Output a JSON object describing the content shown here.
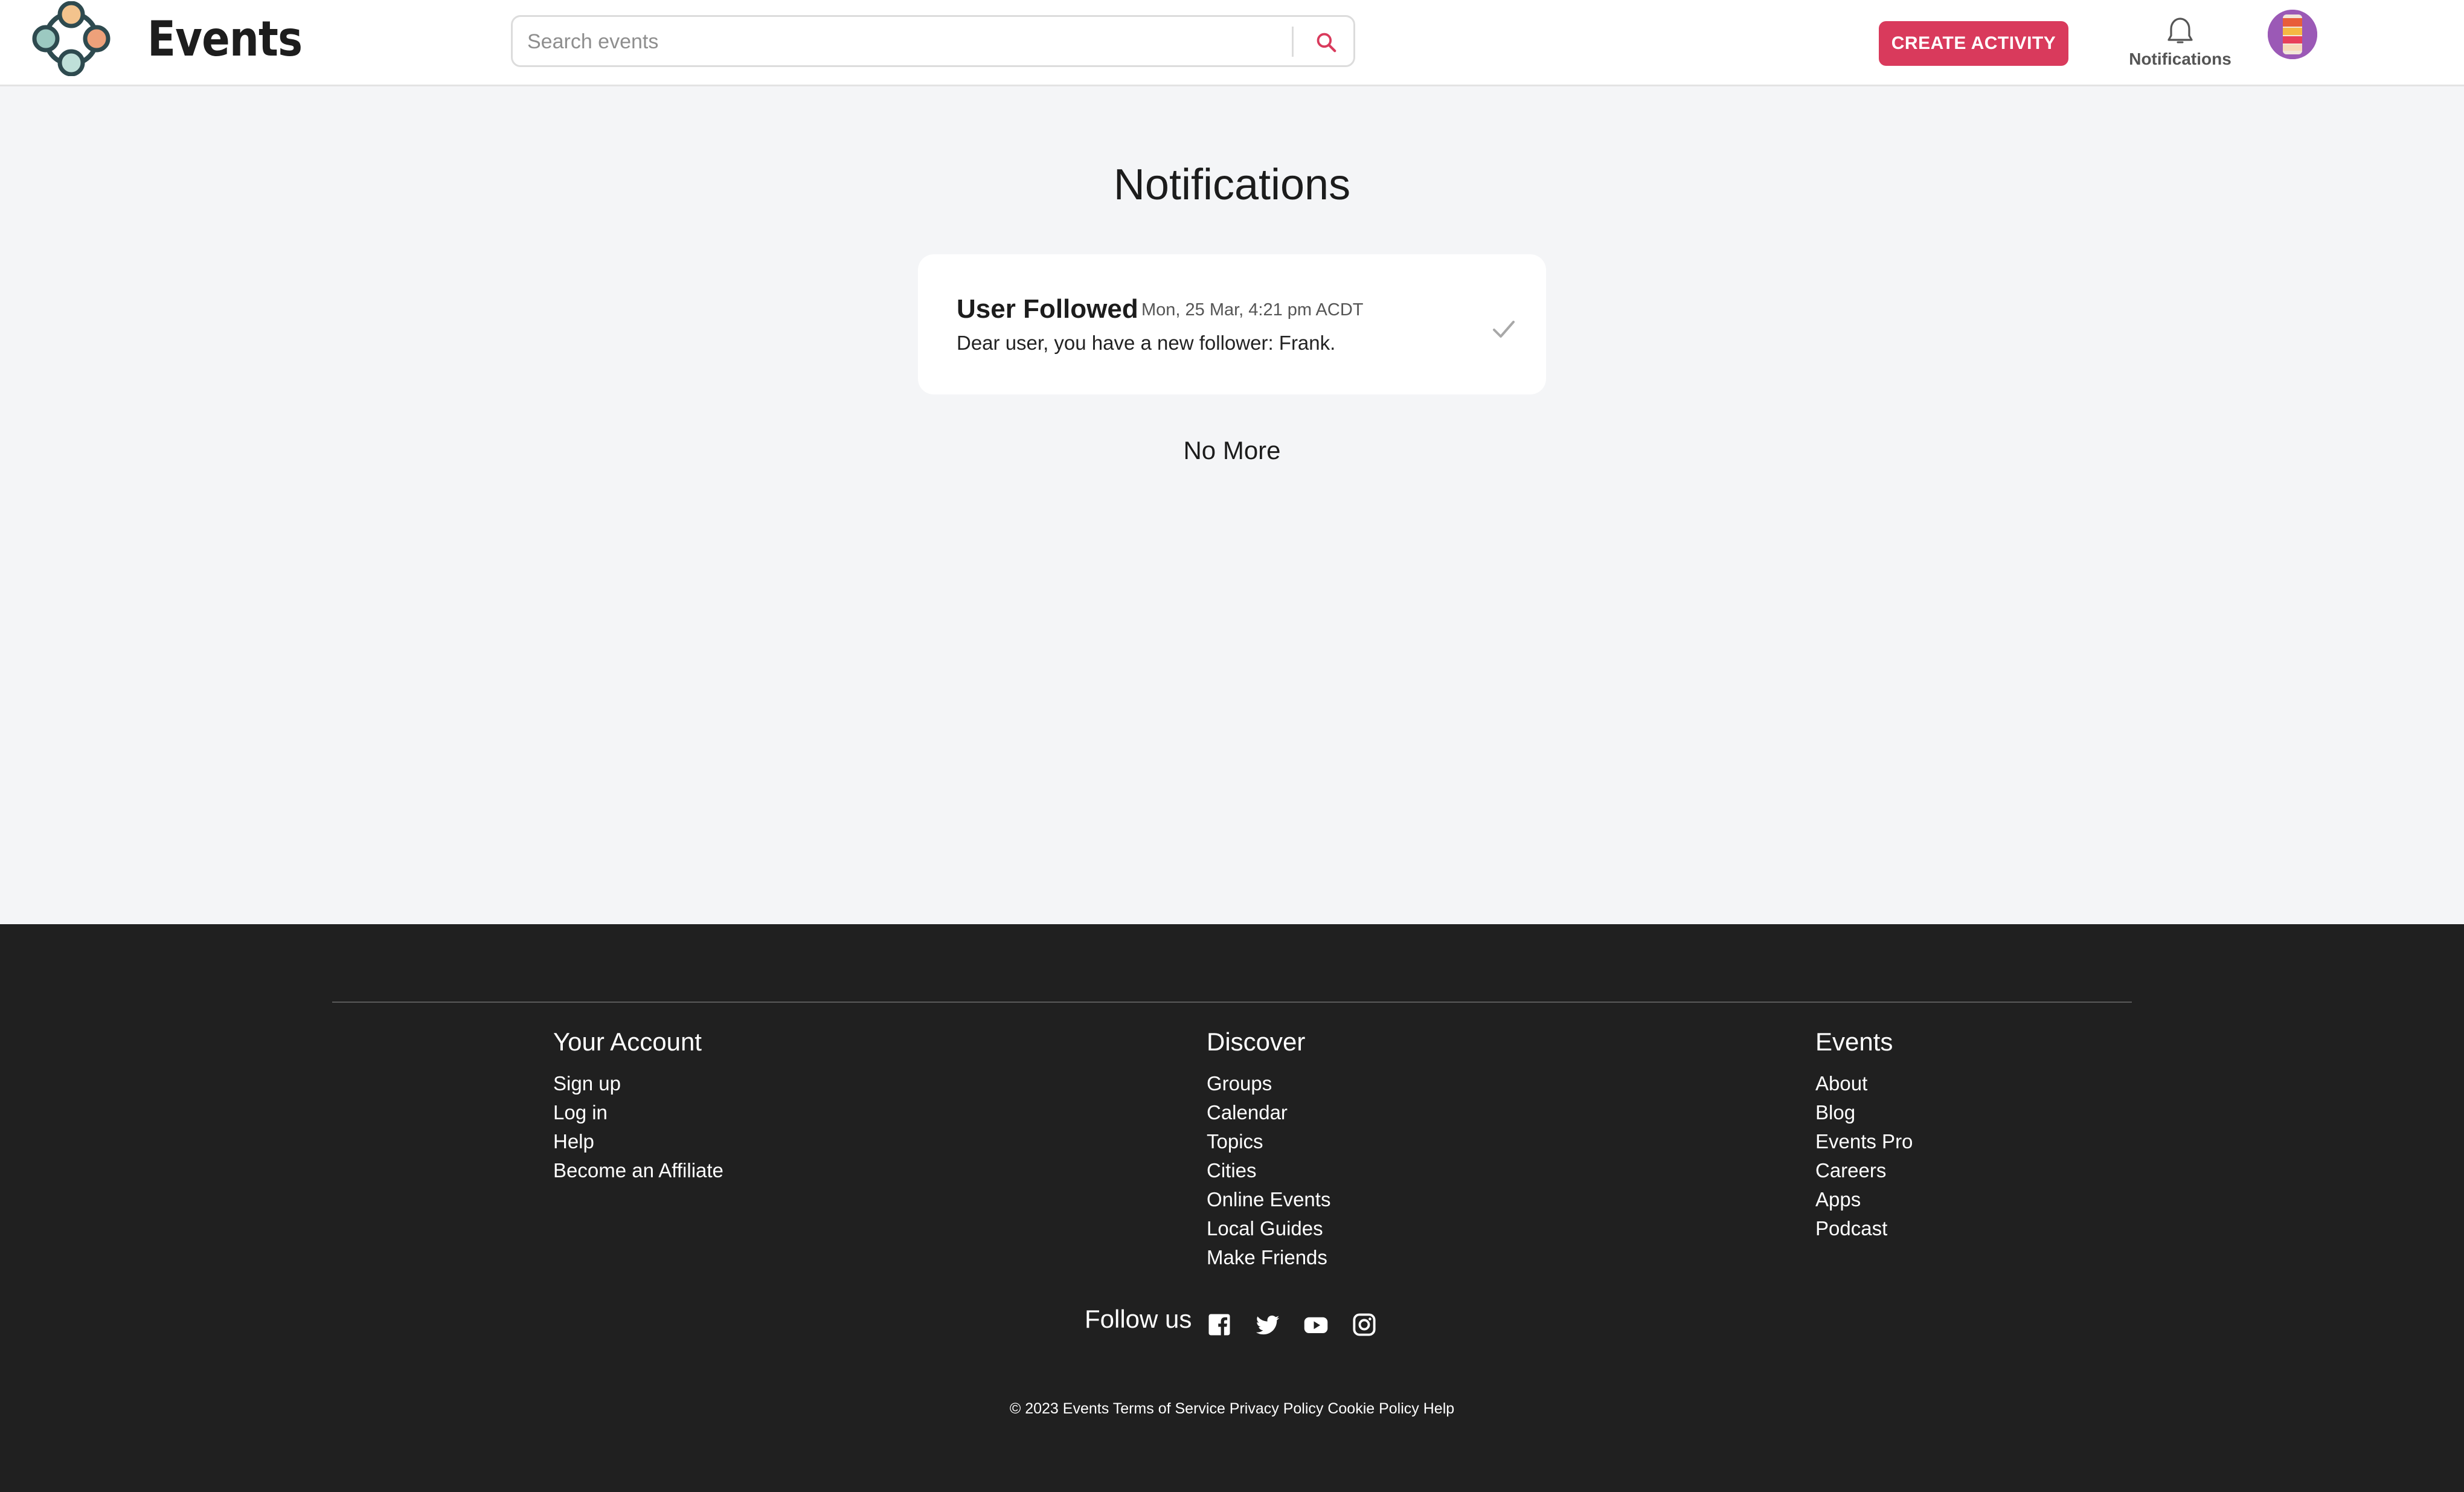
{
  "header": {
    "brand": "Events",
    "search_placeholder": "Search events",
    "create_label": "CREATE ACTIVITY",
    "notifications_label": "Notifications"
  },
  "main": {
    "title": "Notifications",
    "notifications": [
      {
        "title": "User Followed",
        "time": "Mon, 25 Mar, 4:21 pm ACDT",
        "body": "Dear user, you have a new follower: Frank."
      }
    ],
    "end_text": "No More"
  },
  "footer": {
    "columns": [
      {
        "heading": "Your Account",
        "links": [
          "Sign up",
          "Log in",
          "Help",
          "Become an Affiliate"
        ]
      },
      {
        "heading": "Discover",
        "links": [
          "Groups",
          "Calendar",
          "Topics",
          "Cities",
          "Online Events",
          "Local Guides",
          "Make Friends"
        ]
      },
      {
        "heading": "Events",
        "links": [
          "About",
          "Blog",
          "Events Pro",
          "Careers",
          "Apps",
          "Podcast"
        ]
      }
    ],
    "follow_label": "Follow us",
    "social": [
      "facebook-icon",
      "twitter-icon",
      "youtube-icon",
      "instagram-icon"
    ],
    "copyright": "© 2023 Events Terms of Service Privacy Policy Cookie Policy Help"
  },
  "colors": {
    "accent": "#d93a5c",
    "page_bg": "#f4f5f7",
    "footer_bg": "#202020"
  }
}
